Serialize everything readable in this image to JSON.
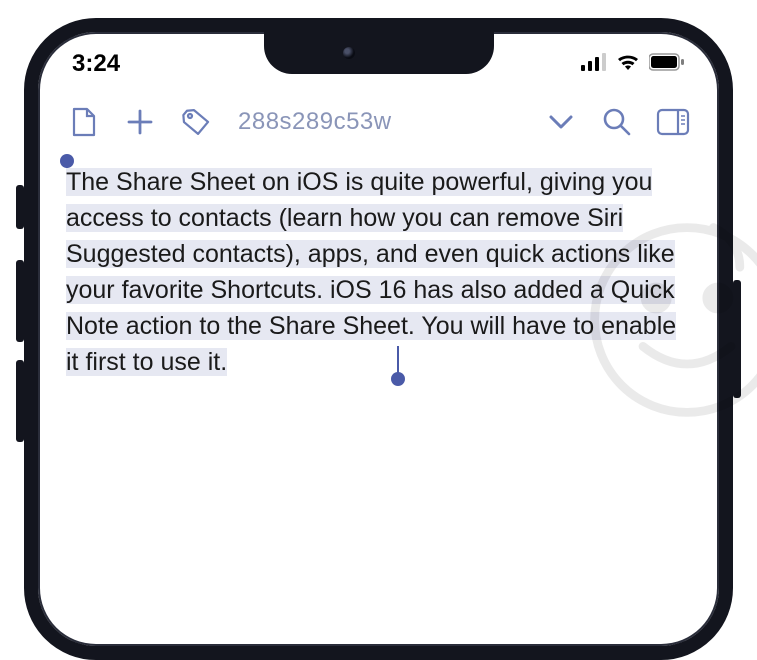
{
  "statusBar": {
    "time": "3:24"
  },
  "toolbar": {
    "title": "288s289c53w"
  },
  "content": {
    "bodyText": "The Share Sheet on iOS is quite powerful, giving you access to contacts (learn how you can remove Siri Suggested contacts), apps, and even quick actions like your favorite Shortcuts. iOS 16 has also added a Quick Note action to the Share Sheet. You will have to enable it first to use it."
  }
}
